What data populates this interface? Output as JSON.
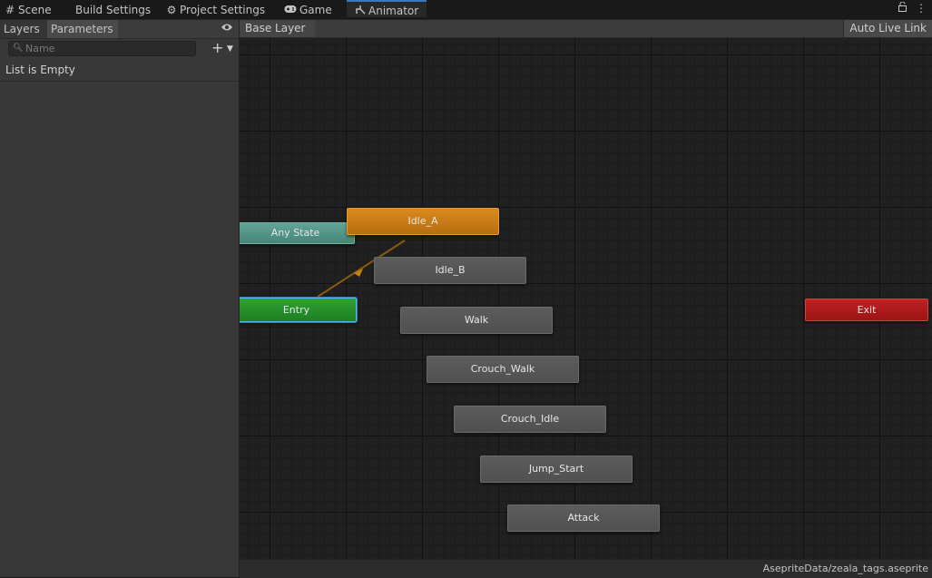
{
  "tabs": [
    {
      "label": "Scene",
      "icon": "grid-icon"
    },
    {
      "label": "Build Settings",
      "icon": ""
    },
    {
      "label": "Project Settings",
      "icon": "gear-icon"
    },
    {
      "label": "Game",
      "icon": "gamepad-icon"
    },
    {
      "label": "Animator",
      "icon": "animator-icon",
      "active": true
    }
  ],
  "left_panel": {
    "tab_layers": "Layers",
    "tab_parameters": "Parameters",
    "search_placeholder": "Name",
    "empty_message": "List is Empty"
  },
  "graph_header": {
    "breadcrumb": "Base Layer",
    "auto_live_link": "Auto Live Link"
  },
  "nodes": {
    "any_state": "Any State",
    "idle_a": "Idle_A",
    "idle_b": "Idle_B",
    "entry": "Entry",
    "walk": "Walk",
    "crouch_walk": "Crouch_Walk",
    "crouch_idle": "Crouch_Idle",
    "jump_start": "Jump_Start",
    "attack": "Attack",
    "exit": "Exit"
  },
  "colors": {
    "default_state": "#d98a1e",
    "entry": "#2fa133",
    "exit": "#c12222",
    "any_state": "#5fa596",
    "state": "#555555",
    "transition": "#8a5a12",
    "selection": "#3a79bb"
  },
  "status_bar": {
    "asset_path": "AsepriteData/zeala_tags.aseprite"
  }
}
